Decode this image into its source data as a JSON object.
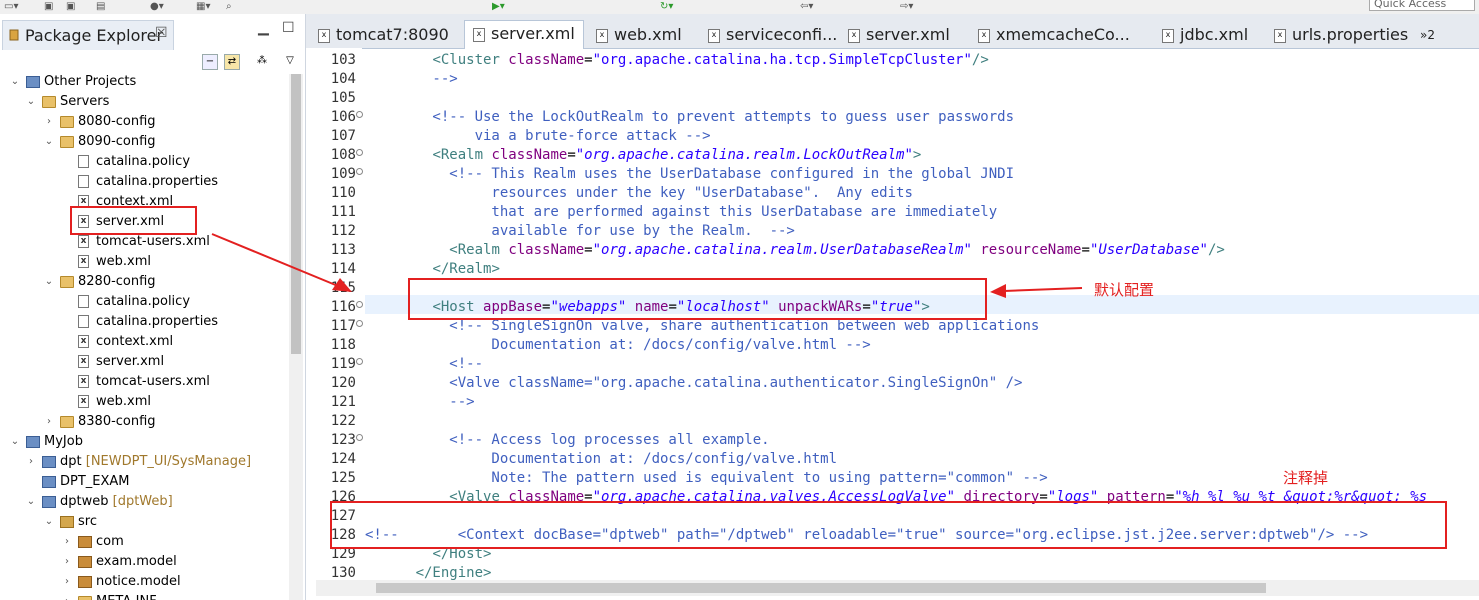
{
  "quick_access": "Quick Access",
  "package_explorer": {
    "title": "Package Explorer",
    "close": "☒"
  },
  "tree": [
    {
      "label": "Other Projects",
      "indent": 0,
      "icon": "proj",
      "tw": "open"
    },
    {
      "label": "Servers",
      "indent": 1,
      "icon": "folder",
      "tw": "open"
    },
    {
      "label": "8080-config",
      "indent": 2,
      "icon": "folder",
      "tw": "closed"
    },
    {
      "label": "8090-config",
      "indent": 2,
      "icon": "folder",
      "tw": "open"
    },
    {
      "label": "catalina.policy",
      "indent": 3,
      "icon": "file",
      "tw": ""
    },
    {
      "label": "catalina.properties",
      "indent": 3,
      "icon": "file",
      "tw": ""
    },
    {
      "label": "context.xml",
      "indent": 3,
      "icon": "xml",
      "tw": ""
    },
    {
      "label": "server.xml",
      "indent": 3,
      "icon": "xml",
      "tw": ""
    },
    {
      "label": "tomcat-users.xml",
      "indent": 3,
      "icon": "xml",
      "tw": ""
    },
    {
      "label": "web.xml",
      "indent": 3,
      "icon": "xml",
      "tw": ""
    },
    {
      "label": "8280-config",
      "indent": 2,
      "icon": "folder",
      "tw": "open"
    },
    {
      "label": "catalina.policy",
      "indent": 3,
      "icon": "file",
      "tw": ""
    },
    {
      "label": "catalina.properties",
      "indent": 3,
      "icon": "file",
      "tw": ""
    },
    {
      "label": "context.xml",
      "indent": 3,
      "icon": "xml",
      "tw": ""
    },
    {
      "label": "server.xml",
      "indent": 3,
      "icon": "xml",
      "tw": ""
    },
    {
      "label": "tomcat-users.xml",
      "indent": 3,
      "icon": "xml",
      "tw": ""
    },
    {
      "label": "web.xml",
      "indent": 3,
      "icon": "xml",
      "tw": ""
    },
    {
      "label": "8380-config",
      "indent": 2,
      "icon": "folder",
      "tw": "closed"
    },
    {
      "label": "MyJob",
      "indent": 0,
      "icon": "proj",
      "tw": "open"
    },
    {
      "label": "dpt",
      "dec": " [NEWDPT_UI/SysManage]",
      "indent": 1,
      "icon": "proj",
      "tw": "closed"
    },
    {
      "label": "DPT_EXAM",
      "indent": 1,
      "icon": "proj",
      "tw": ""
    },
    {
      "label": "dptweb",
      "dec": " [dptWeb]",
      "indent": 1,
      "icon": "proj",
      "tw": "open"
    },
    {
      "label": "src",
      "indent": 2,
      "icon": "srcf",
      "tw": "open"
    },
    {
      "label": "com",
      "indent": 3,
      "icon": "pkg",
      "tw": "closed"
    },
    {
      "label": "exam.model",
      "indent": 3,
      "icon": "pkg",
      "tw": "closed"
    },
    {
      "label": "notice.model",
      "indent": 3,
      "icon": "pkg",
      "tw": "closed"
    },
    {
      "label": "META-INF",
      "indent": 3,
      "icon": "folder",
      "tw": "closed"
    }
  ],
  "editor_tabs": [
    {
      "label": "tomcat7:8090",
      "active": false
    },
    {
      "label": "server.xml",
      "active": true
    },
    {
      "label": "web.xml",
      "active": false
    },
    {
      "label": "serviceconfi...",
      "active": false
    },
    {
      "label": "server.xml",
      "active": false
    },
    {
      "label": "xmemcacheCo...",
      "active": false
    },
    {
      "label": "jdbc.xml",
      "active": false
    },
    {
      "label": "urls.properties",
      "active": false
    }
  ],
  "tabs_overflow": "»2",
  "code_lines": [
    {
      "n": "103",
      "fold": false,
      "segs": [
        [
          "t",
          "        "
        ],
        [
          "tag",
          "<Cluster "
        ],
        [
          "att",
          "className"
        ],
        [
          "t",
          "="
        ],
        [
          "valn",
          "\"org.apache.catalina.ha.tcp.SimpleTcpCluster\""
        ],
        [
          "tag",
          "/>"
        ]
      ]
    },
    {
      "n": "104",
      "fold": false,
      "segs": [
        [
          "com",
          "        -->"
        ]
      ]
    },
    {
      "n": "105",
      "fold": false,
      "segs": []
    },
    {
      "n": "106",
      "fold": true,
      "segs": [
        [
          "com",
          "        <!-- Use the LockOutRealm to prevent attempts to guess user passwords"
        ]
      ]
    },
    {
      "n": "107",
      "fold": false,
      "segs": [
        [
          "com",
          "             via a brute-force attack -->"
        ]
      ]
    },
    {
      "n": "108",
      "fold": true,
      "segs": [
        [
          "t",
          "        "
        ],
        [
          "tag",
          "<Realm "
        ],
        [
          "att",
          "className"
        ],
        [
          "t",
          "="
        ],
        [
          "val",
          "\"org.apache.catalina.realm.LockOutRealm\""
        ],
        [
          "tag",
          ">"
        ]
      ]
    },
    {
      "n": "109",
      "fold": true,
      "segs": [
        [
          "com",
          "          <!-- This Realm uses the UserDatabase configured in the global JNDI"
        ]
      ]
    },
    {
      "n": "110",
      "fold": false,
      "segs": [
        [
          "com",
          "               resources under the key \"UserDatabase\".  Any edits"
        ]
      ]
    },
    {
      "n": "111",
      "fold": false,
      "segs": [
        [
          "com",
          "               that are performed against this UserDatabase are immediately"
        ]
      ]
    },
    {
      "n": "112",
      "fold": false,
      "segs": [
        [
          "com",
          "               available for use by the Realm.  -->"
        ]
      ]
    },
    {
      "n": "113",
      "fold": false,
      "segs": [
        [
          "t",
          "          "
        ],
        [
          "tag",
          "<Realm "
        ],
        [
          "att",
          "className"
        ],
        [
          "t",
          "="
        ],
        [
          "val",
          "\"org.apache.catalina.realm.UserDatabaseRealm\""
        ],
        [
          "t",
          " "
        ],
        [
          "att",
          "resourceName"
        ],
        [
          "t",
          "="
        ],
        [
          "val",
          "\"UserDatabase\""
        ],
        [
          "tag",
          "/>"
        ]
      ]
    },
    {
      "n": "114",
      "fold": false,
      "segs": [
        [
          "t",
          "        "
        ],
        [
          "tag",
          "</Realm>"
        ]
      ]
    },
    {
      "n": "115",
      "fold": false,
      "segs": []
    },
    {
      "n": "116",
      "fold": true,
      "segs": [
        [
          "t",
          "        "
        ],
        [
          "tag",
          "<Host "
        ],
        [
          "att",
          "appBase"
        ],
        [
          "t",
          "="
        ],
        [
          "val",
          "\"webapps\""
        ],
        [
          "t",
          " "
        ],
        [
          "att",
          "name"
        ],
        [
          "t",
          "="
        ],
        [
          "val",
          "\"localhost\""
        ],
        [
          "t",
          " "
        ],
        [
          "att",
          "unpackWARs"
        ],
        [
          "t",
          "="
        ],
        [
          "val",
          "\"true\""
        ],
        [
          "tag",
          ">"
        ]
      ]
    },
    {
      "n": "117",
      "fold": true,
      "segs": [
        [
          "com",
          "          <!-- SingleSignOn valve, share authentication between web applications"
        ]
      ]
    },
    {
      "n": "118",
      "fold": false,
      "segs": [
        [
          "com",
          "               Documentation at: /docs/config/valve.html -->"
        ]
      ]
    },
    {
      "n": "119",
      "fold": true,
      "segs": [
        [
          "com",
          "          <!--"
        ]
      ]
    },
    {
      "n": "120",
      "fold": false,
      "segs": [
        [
          "com",
          "          <Valve className=\"org.apache.catalina.authenticator.SingleSignOn\" />"
        ]
      ]
    },
    {
      "n": "121",
      "fold": false,
      "segs": [
        [
          "com",
          "          -->"
        ]
      ]
    },
    {
      "n": "122",
      "fold": false,
      "segs": []
    },
    {
      "n": "123",
      "fold": true,
      "segs": [
        [
          "com",
          "          <!-- Access log processes all example."
        ]
      ]
    },
    {
      "n": "124",
      "fold": false,
      "segs": [
        [
          "com",
          "               Documentation at: /docs/config/valve.html"
        ]
      ]
    },
    {
      "n": "125",
      "fold": false,
      "segs": [
        [
          "com",
          "               Note: The pattern used is equivalent to using pattern=\"common\" -->"
        ]
      ]
    },
    {
      "n": "126",
      "fold": false,
      "segs": [
        [
          "t",
          "          "
        ],
        [
          "tag",
          "<Valve "
        ],
        [
          "att",
          "className"
        ],
        [
          "t",
          "="
        ],
        [
          "val",
          "\"org.apache.catalina.valves.AccessLogValve\""
        ],
        [
          "t",
          " "
        ],
        [
          "att",
          "directory"
        ],
        [
          "t",
          "="
        ],
        [
          "val",
          "\"logs\""
        ],
        [
          "t",
          " "
        ],
        [
          "att",
          "pattern"
        ],
        [
          "t",
          "="
        ],
        [
          "val",
          "\"%h %l %u %t &quot;%r&quot; %s"
        ]
      ]
    },
    {
      "n": "127",
      "fold": false,
      "segs": []
    },
    {
      "n": "128",
      "fold": false,
      "segs": [
        [
          "com",
          "<!--       <Context docBase=\"dptweb\" path=\"/dptweb\" reloadable=\"true\" source=\"org.eclipse.jst.j2ee.server:dptweb\"/> -->"
        ]
      ]
    },
    {
      "n": "129",
      "fold": false,
      "segs": [
        [
          "t",
          "        "
        ],
        [
          "tag",
          "</Host>"
        ]
      ]
    },
    {
      "n": "130",
      "fold": false,
      "segs": [
        [
          "t",
          "      "
        ],
        [
          "tag",
          "</Engine>"
        ]
      ]
    }
  ],
  "annotations": {
    "default_config": "默认配置",
    "comment_out": "注释掉"
  },
  "colors": {
    "annotation_red": "#e32020",
    "comment": "#3f5fbf",
    "tag": "#3f7f7f",
    "attribute": "#7f007f",
    "value": "#2a00ff"
  }
}
